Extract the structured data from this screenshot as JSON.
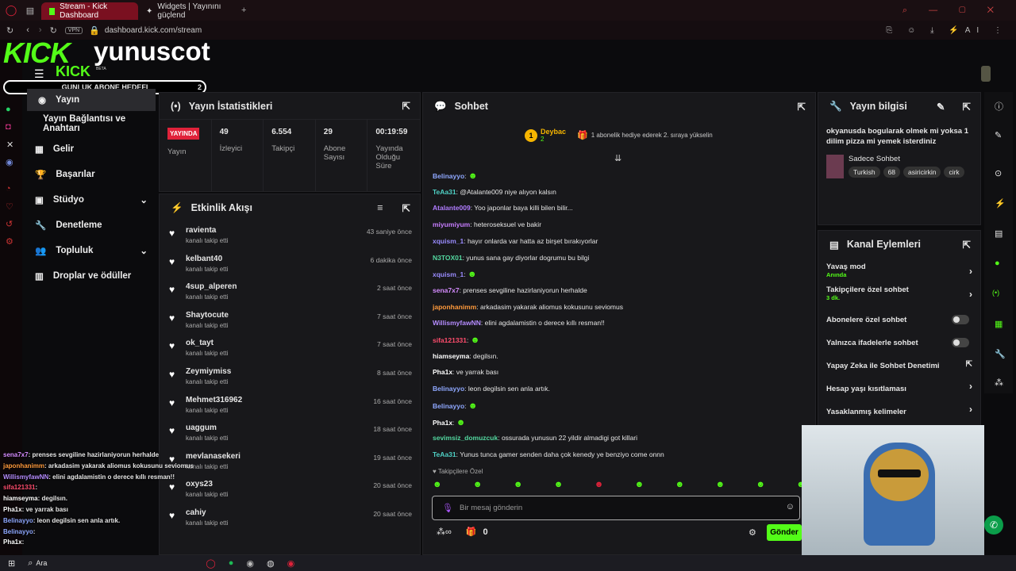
{
  "browser": {
    "tab1": "Stream - Kick Dashboard",
    "tab2": "Widgets | Yayınını güçlend",
    "url": "dashboard.kick.com/stream",
    "vpn": "VPN",
    "ai": "AI"
  },
  "overlay": {
    "logo": "KICK",
    "channel": "yunuscot",
    "small_logo": "KICK",
    "beta": "BETA",
    "goal_label": "GUNLUK ABONE HEDEFI",
    "goal_value": "2"
  },
  "sidebar": {
    "items": [
      {
        "label": "Yayın"
      },
      {
        "label": "Yayın Bağlantısı ve Anahtarı"
      },
      {
        "label": "Gelir"
      },
      {
        "label": "Başarılar"
      },
      {
        "label": "Stüdyo"
      },
      {
        "label": "Denetleme"
      },
      {
        "label": "Topluluk"
      },
      {
        "label": "Droplar ve ödüller"
      }
    ]
  },
  "stats": {
    "title": "Yayın İstatistikleri",
    "live_badge": "YAYINDA",
    "live_label": "Yayın",
    "viewers": "49",
    "viewers_label": "İzleyici",
    "followers": "6.554",
    "followers_label": "Takipçi",
    "subs": "29",
    "subs_label": "Abone Sayısı",
    "uptime": "00:19:59",
    "uptime_label": "Yayında Olduğu Süre"
  },
  "activity": {
    "title": "Etkinlik Akışı",
    "items": [
      {
        "name": "ravienta",
        "sub": "kanalı takip etti",
        "time": "43 saniye önce"
      },
      {
        "name": "kelbant40",
        "sub": "kanalı takip etti",
        "time": "6 dakika önce"
      },
      {
        "name": "4sup_alperen",
        "sub": "kanalı takip etti",
        "time": "2 saat önce"
      },
      {
        "name": "Shaytocute",
        "sub": "kanalı takip etti",
        "time": "7 saat önce"
      },
      {
        "name": "ok_tayt",
        "sub": "kanalı takip etti",
        "time": "7 saat önce"
      },
      {
        "name": "Zeymiymiss",
        "sub": "kanalı takip etti",
        "time": "8 saat önce"
      },
      {
        "name": "Mehmet316962",
        "sub": "kanalı takip etti",
        "time": "16 saat önce"
      },
      {
        "name": "uaggum",
        "sub": "kanalı takip etti",
        "time": "18 saat önce"
      },
      {
        "name": "mevlanasekeri",
        "sub": "kanalı takip etti",
        "time": "19 saat önce"
      },
      {
        "name": "oxys23",
        "sub": "kanalı takip etti",
        "time": "20 saat önce"
      },
      {
        "name": "cahiy",
        "sub": "kanalı takip etti",
        "time": "20 saat önce"
      }
    ]
  },
  "chat": {
    "title": "Sohbet",
    "top_user": "Deybac",
    "top_count": "2",
    "promo": "1 abonelik hediye ederek 2. sıraya yükselin",
    "followers_only": "Takipçilere Özel",
    "placeholder": "Bir mesaj gönderin",
    "points": "0",
    "send": "Gönder",
    "messages": [
      {
        "user": "Belinayyo",
        "color": "#8fa8ff",
        "text": ""
      },
      {
        "user": "TeAa31",
        "color": "#4fd1c5",
        "text": "@Atalante009 niye alıyon kalsın"
      },
      {
        "user": "Atalante009",
        "color": "#b07cff",
        "text": "Yoo japonlar baya killi bilen bilir..."
      },
      {
        "user": "miyumiyum",
        "color": "#c77dff",
        "text": "heteroseksuel ve bakir"
      },
      {
        "user": "xquism_1",
        "color": "#9a8cff",
        "text": "hayır onlarda var hatta az birşet bırakıyorlar"
      },
      {
        "user": "N3TOX01",
        "color": "#53d8a0",
        "text": "yunus sana gay diyorlar dogrumu bu bilgi"
      },
      {
        "user": "xquism_1",
        "color": "#9a8cff",
        "text": ""
      },
      {
        "user": "sena7x7",
        "color": "#d58cff",
        "text": "prenses sevgiline hazirlaniyorun herhalde"
      },
      {
        "user": "japonhanimm",
        "color": "#ff9a3c",
        "text": "arkadasim yakarak aliomus kokusunu seviomus"
      },
      {
        "user": "WillismyfawNN",
        "color": "#b58cff",
        "text": "elini agdalamistin o derece kıllı resman!!"
      },
      {
        "user": "sifa121331",
        "color": "#ff4d6d",
        "text": ""
      },
      {
        "user": "hiamseyma",
        "color": "#ffffff",
        "text": "degilsın."
      },
      {
        "user": "Pha1x",
        "color": "#ffffff",
        "text": "ve yarrak bası"
      },
      {
        "user": "Belinayyo",
        "color": "#8fa8ff",
        "text": "leon degilsin sen anla artık."
      },
      {
        "user": "Belinayyo",
        "color": "#8fa8ff",
        "text": ""
      },
      {
        "user": "Pha1x",
        "color": "#ffffff",
        "text": ""
      },
      {
        "user": "sevimsiz_domuzcuk",
        "color": "#53d8a0",
        "text": "ossurada yunusun 22 yildir almadigi got killari"
      },
      {
        "user": "TeAa31",
        "color": "#4fd1c5",
        "text": "Yunus tunca gamer senden daha çok kenedy ye benziyo come onnn"
      }
    ]
  },
  "info": {
    "title": "Yayın bilgisi",
    "stream_title": "okyanusda bogularak olmek mi yoksa 1 dilim pizza mi yemek isterdiniz",
    "category": "Sadece Sohbet",
    "tags": [
      "Turkish",
      "68",
      "asiricirkin",
      "cirk"
    ]
  },
  "actions": {
    "title": "Kanal Eylemleri",
    "slow": "Yavaş mod",
    "slow_sub": "Anında",
    "followers": "Takipçilere özel sohbet",
    "followers_sub": "3 dk.",
    "subs": "Abonelere özel sohbet",
    "emotes": "Yalnızca ifadelerle sohbet",
    "ai": "Yapay Zeka ile Sohbet Denetimi",
    "age": "Hesap yaşı kısıtlaması",
    "banned": "Yasaklanmış kelimeler"
  },
  "obs_chat": [
    {
      "user": "sena7x7",
      "text": ": prenses sevgiline hazirlaniyorun herhalde",
      "color": "#d58cff"
    },
    {
      "user": "japonhanimm",
      "text": ": arkadasim yakarak aliomus kokusunu seviomus",
      "color": "#ff9a3c"
    },
    {
      "user": "WillismyfawNN",
      "text": ": elini agdalamistin o derece kıllı resman!!",
      "color": "#b58cff"
    },
    {
      "user": "sifa121331",
      "text": ":",
      "color": "#ff4d6d"
    },
    {
      "user": "hiamseyma",
      "text": ": degilsın.",
      "color": "#ffffff"
    },
    {
      "user": "Pha1x",
      "text": ": ve yarrak bası",
      "color": "#ffffff"
    },
    {
      "user": "Belinayyo",
      "text": ": leon degilsin sen anla artık.",
      "color": "#8fa8ff"
    },
    {
      "user": "Belinayyo",
      "text": ":",
      "color": "#8fa8ff"
    },
    {
      "user": "Pha1x",
      "text": ":",
      "color": "#ffffff"
    }
  ],
  "taskbar": {
    "search": "Ara"
  }
}
